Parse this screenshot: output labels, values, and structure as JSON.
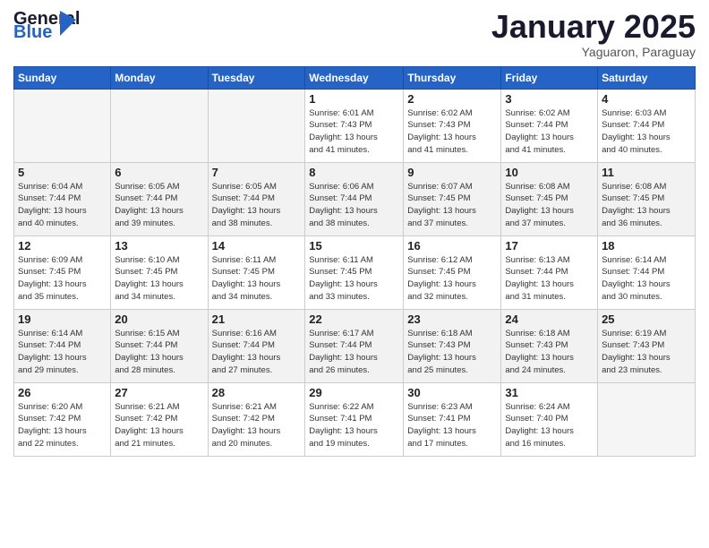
{
  "header": {
    "logo_general": "General",
    "logo_blue": "Blue",
    "month_title": "January 2025",
    "subtitle": "Yaguaron, Paraguay"
  },
  "days_of_week": [
    "Sunday",
    "Monday",
    "Tuesday",
    "Wednesday",
    "Thursday",
    "Friday",
    "Saturday"
  ],
  "weeks": [
    [
      {
        "day": "",
        "info": ""
      },
      {
        "day": "",
        "info": ""
      },
      {
        "day": "",
        "info": ""
      },
      {
        "day": "1",
        "info": "Sunrise: 6:01 AM\nSunset: 7:43 PM\nDaylight: 13 hours\nand 41 minutes."
      },
      {
        "day": "2",
        "info": "Sunrise: 6:02 AM\nSunset: 7:43 PM\nDaylight: 13 hours\nand 41 minutes."
      },
      {
        "day": "3",
        "info": "Sunrise: 6:02 AM\nSunset: 7:44 PM\nDaylight: 13 hours\nand 41 minutes."
      },
      {
        "day": "4",
        "info": "Sunrise: 6:03 AM\nSunset: 7:44 PM\nDaylight: 13 hours\nand 40 minutes."
      }
    ],
    [
      {
        "day": "5",
        "info": "Sunrise: 6:04 AM\nSunset: 7:44 PM\nDaylight: 13 hours\nand 40 minutes."
      },
      {
        "day": "6",
        "info": "Sunrise: 6:05 AM\nSunset: 7:44 PM\nDaylight: 13 hours\nand 39 minutes."
      },
      {
        "day": "7",
        "info": "Sunrise: 6:05 AM\nSunset: 7:44 PM\nDaylight: 13 hours\nand 38 minutes."
      },
      {
        "day": "8",
        "info": "Sunrise: 6:06 AM\nSunset: 7:44 PM\nDaylight: 13 hours\nand 38 minutes."
      },
      {
        "day": "9",
        "info": "Sunrise: 6:07 AM\nSunset: 7:45 PM\nDaylight: 13 hours\nand 37 minutes."
      },
      {
        "day": "10",
        "info": "Sunrise: 6:08 AM\nSunset: 7:45 PM\nDaylight: 13 hours\nand 37 minutes."
      },
      {
        "day": "11",
        "info": "Sunrise: 6:08 AM\nSunset: 7:45 PM\nDaylight: 13 hours\nand 36 minutes."
      }
    ],
    [
      {
        "day": "12",
        "info": "Sunrise: 6:09 AM\nSunset: 7:45 PM\nDaylight: 13 hours\nand 35 minutes."
      },
      {
        "day": "13",
        "info": "Sunrise: 6:10 AM\nSunset: 7:45 PM\nDaylight: 13 hours\nand 34 minutes."
      },
      {
        "day": "14",
        "info": "Sunrise: 6:11 AM\nSunset: 7:45 PM\nDaylight: 13 hours\nand 34 minutes."
      },
      {
        "day": "15",
        "info": "Sunrise: 6:11 AM\nSunset: 7:45 PM\nDaylight: 13 hours\nand 33 minutes."
      },
      {
        "day": "16",
        "info": "Sunrise: 6:12 AM\nSunset: 7:45 PM\nDaylight: 13 hours\nand 32 minutes."
      },
      {
        "day": "17",
        "info": "Sunrise: 6:13 AM\nSunset: 7:44 PM\nDaylight: 13 hours\nand 31 minutes."
      },
      {
        "day": "18",
        "info": "Sunrise: 6:14 AM\nSunset: 7:44 PM\nDaylight: 13 hours\nand 30 minutes."
      }
    ],
    [
      {
        "day": "19",
        "info": "Sunrise: 6:14 AM\nSunset: 7:44 PM\nDaylight: 13 hours\nand 29 minutes."
      },
      {
        "day": "20",
        "info": "Sunrise: 6:15 AM\nSunset: 7:44 PM\nDaylight: 13 hours\nand 28 minutes."
      },
      {
        "day": "21",
        "info": "Sunrise: 6:16 AM\nSunset: 7:44 PM\nDaylight: 13 hours\nand 27 minutes."
      },
      {
        "day": "22",
        "info": "Sunrise: 6:17 AM\nSunset: 7:44 PM\nDaylight: 13 hours\nand 26 minutes."
      },
      {
        "day": "23",
        "info": "Sunrise: 6:18 AM\nSunset: 7:43 PM\nDaylight: 13 hours\nand 25 minutes."
      },
      {
        "day": "24",
        "info": "Sunrise: 6:18 AM\nSunset: 7:43 PM\nDaylight: 13 hours\nand 24 minutes."
      },
      {
        "day": "25",
        "info": "Sunrise: 6:19 AM\nSunset: 7:43 PM\nDaylight: 13 hours\nand 23 minutes."
      }
    ],
    [
      {
        "day": "26",
        "info": "Sunrise: 6:20 AM\nSunset: 7:42 PM\nDaylight: 13 hours\nand 22 minutes."
      },
      {
        "day": "27",
        "info": "Sunrise: 6:21 AM\nSunset: 7:42 PM\nDaylight: 13 hours\nand 21 minutes."
      },
      {
        "day": "28",
        "info": "Sunrise: 6:21 AM\nSunset: 7:42 PM\nDaylight: 13 hours\nand 20 minutes."
      },
      {
        "day": "29",
        "info": "Sunrise: 6:22 AM\nSunset: 7:41 PM\nDaylight: 13 hours\nand 19 minutes."
      },
      {
        "day": "30",
        "info": "Sunrise: 6:23 AM\nSunset: 7:41 PM\nDaylight: 13 hours\nand 17 minutes."
      },
      {
        "day": "31",
        "info": "Sunrise: 6:24 AM\nSunset: 7:40 PM\nDaylight: 13 hours\nand 16 minutes."
      },
      {
        "day": "",
        "info": ""
      }
    ]
  ]
}
